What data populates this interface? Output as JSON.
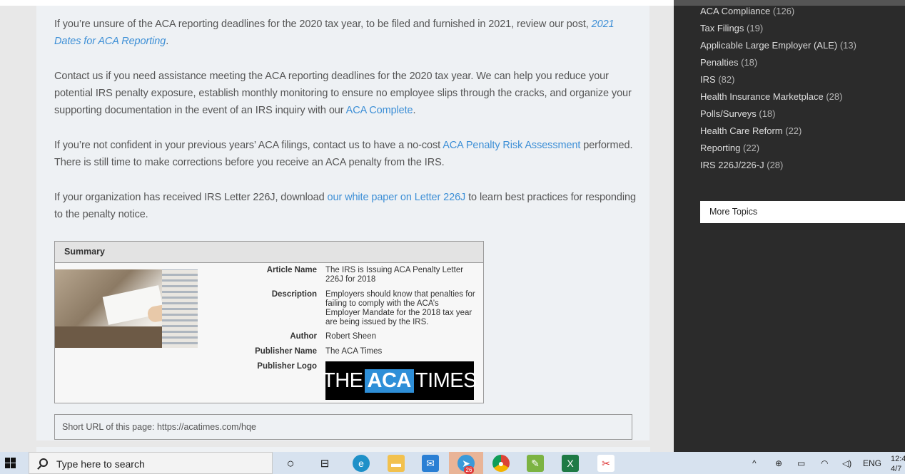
{
  "article": {
    "p1_text": "If you’re unsure of the ACA reporting deadlines for the 2020 tax year, to be filed and furnished in 2021, review our post, ",
    "p1_link": "2021 Dates for ACA Reporting",
    "p1_end": ".",
    "p2_text": "Contact us if you need assistance meeting the ACA reporting deadlines for the 2020 tax year. We can help you reduce your potential IRS penalty exposure, establish monthly monitoring to ensure no employee slips through the cracks, and organize your supporting documentation in the event of an IRS inquiry with our ",
    "p2_link": "ACA Complete",
    "p2_end": ".",
    "p3_text": "If you’re not confident in your previous years’ ACA filings, contact us to have a no-cost ",
    "p3_link": "ACA Penalty Risk Assessment",
    "p3_end": " performed. There is still time to make corrections before you receive an ACA penalty from the IRS.",
    "p4_text": "If your organization has received IRS Letter 226J, download ",
    "p4_link": "our white paper on Letter 226J",
    "p4_end": " to learn best practices for responding to the penalty notice."
  },
  "summary": {
    "heading": "Summary",
    "article_name_label": "Article Name",
    "article_name": "The IRS is Issuing ACA Penalty Letter 226J for 2018",
    "description_label": "Description",
    "description": "Employers should know that penalties for failing to comply with the ACA’s Employer Mandate for the 2018 tax year are being issued by the IRS.",
    "author_label": "Author",
    "author": "Robert Sheen",
    "publisher_name_label": "Publisher Name",
    "publisher_name": "The ACA Times",
    "publisher_logo_label": "Publisher Logo",
    "logo_the": "THE",
    "logo_aca": "ACA",
    "logo_times": "TIMES"
  },
  "short_url": "Short URL of this page: https://acatimes.com/hqe",
  "sidebar": {
    "items": [
      {
        "label": "ACA Compliance",
        "count": "(126)"
      },
      {
        "label": "Tax Filings",
        "count": "(19)"
      },
      {
        "label": "Applicable Large Employer (ALE)",
        "count": "(13)"
      },
      {
        "label": "Penalties",
        "count": "(18)"
      },
      {
        "label": "IRS",
        "count": "(82)"
      },
      {
        "label": "Health Insurance Marketplace",
        "count": "(28)"
      },
      {
        "label": "Polls/Surveys",
        "count": "(18)"
      },
      {
        "label": "Health Care Reform",
        "count": "(22)"
      },
      {
        "label": "Reporting",
        "count": "(22)"
      },
      {
        "label": "IRS 226J/226-J",
        "count": "(28)"
      }
    ],
    "more_topics": "More Topics"
  },
  "taskbar": {
    "search_placeholder": "Type here to search",
    "badge": "26",
    "lang": "ENG",
    "time": "12:4",
    "date": "4/7"
  },
  "colors": {
    "link": "#3d8fd6",
    "sidebar_bg": "#2b2b2b",
    "logo_accent": "#2e8fd8"
  }
}
